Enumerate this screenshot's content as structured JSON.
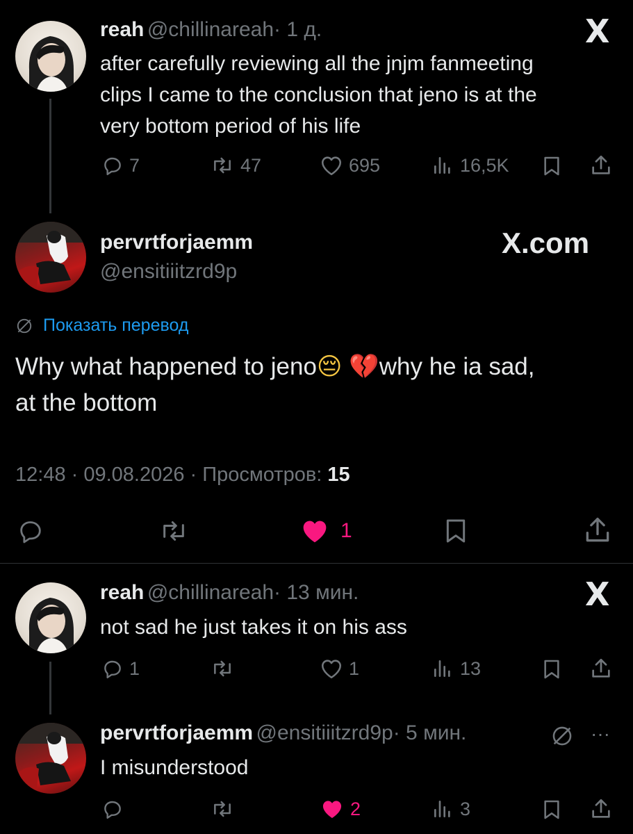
{
  "tweet1": {
    "name": "reah",
    "handle": "@chillinareah",
    "time": "· 1 д.",
    "text_lines": [
      "after carefully reviewing all the jnjm fanmeeting",
      "clips I came to the conclusion that jeno is at the",
      "very bottom period of his life"
    ],
    "replies": "7",
    "reposts": "47",
    "likes": "695",
    "views": "16,5K",
    "x_logo": "X"
  },
  "main": {
    "name": "pervrtforjaemm",
    "handle": "@ensitiiitzrd9p",
    "brand": "X.com",
    "translate_label": "Показать перевод",
    "text_line1": "Why what happened to jeno",
    "emoji_pensive": "😔",
    "emoji_heart": "💔",
    "text_line1_end": "why he ia sad,",
    "text_line2": "at the bottom",
    "meta_prefix": "12:48 · 09.08.2026 · Просмотров: ",
    "meta_views": "15",
    "likes": "1"
  },
  "tweet2": {
    "name": "reah",
    "handle": "@chillinareah",
    "time": "· 13 мин.",
    "text": "not sad he just takes it on his ass",
    "replies": "1",
    "likes": "1",
    "views": "13",
    "x_logo": "X"
  },
  "tweet3": {
    "name": "pervrtforjaemm",
    "handle": "@ensitiiitzrd9p",
    "time": "· 5 мин.",
    "text": "I misunderstood",
    "likes": "2",
    "views": "3",
    "more": "···"
  },
  "colors": {
    "accent": "#1d9bf0",
    "like": "#f91880",
    "muted": "#71767b"
  }
}
